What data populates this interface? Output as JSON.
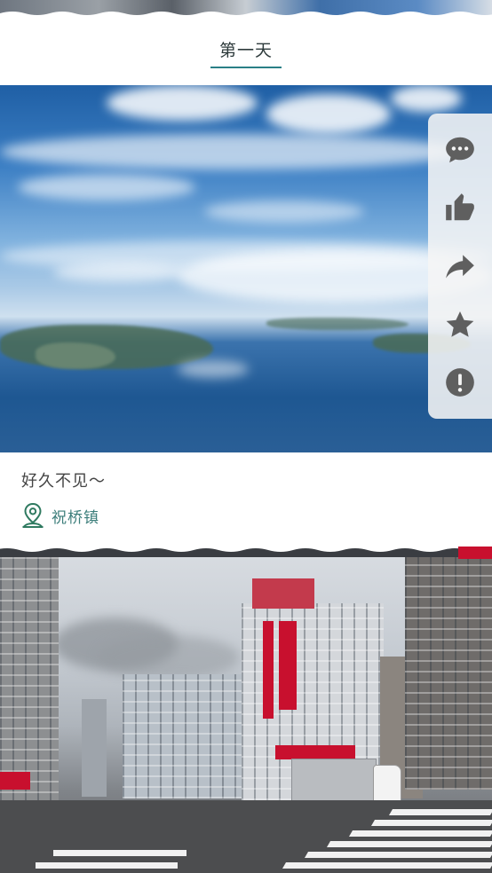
{
  "day": {
    "title": "第一天"
  },
  "post": {
    "caption": "好久不见～",
    "location": "祝桥镇"
  },
  "actions": [
    {
      "icon": "comment-icon"
    },
    {
      "icon": "thumbs-up-icon"
    },
    {
      "icon": "share-arrow-icon"
    },
    {
      "icon": "star-icon"
    },
    {
      "icon": "alert-icon"
    }
  ],
  "colors": {
    "accent": "#2a7f86",
    "location_text": "#3b7d7a",
    "action_icon": "#5f5f5f"
  }
}
